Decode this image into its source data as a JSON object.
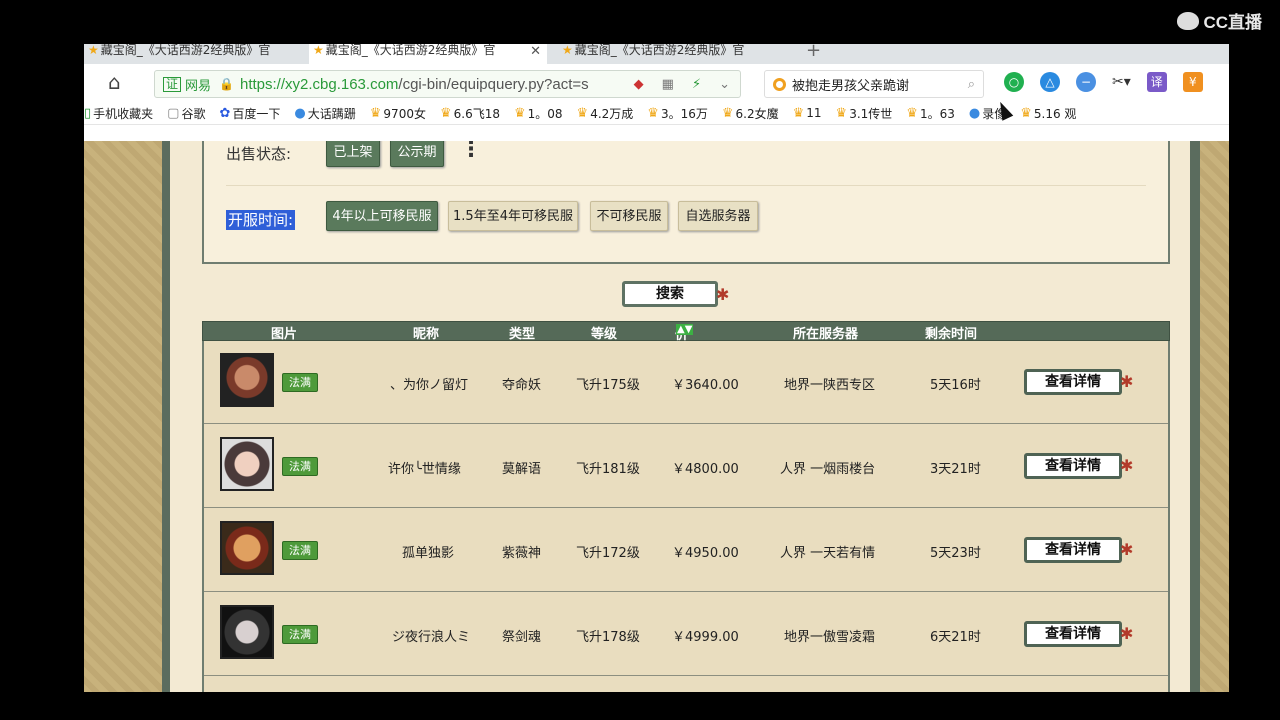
{
  "overlay": {
    "logo_text": "CC直播"
  },
  "tabs": [
    {
      "label": "藏宝阁_《大话西游2经典版》官",
      "active": false
    },
    {
      "label": "藏宝阁_《大话西游2经典版》官",
      "active": true
    },
    {
      "label": "藏宝阁_《大话西游2经典版》官",
      "active": false
    }
  ],
  "address": {
    "cert": "证",
    "site": "网易",
    "url_host": "https://xy2.cbg.163.com",
    "url_path": "/cgi-bin/equipquery.py?act=s"
  },
  "search_box": {
    "value": "被抱走男孩父亲跪谢"
  },
  "ext_translate": "译",
  "bookmarks": [
    {
      "label": "手机收藏夹"
    },
    {
      "label": "谷歌"
    },
    {
      "label": "百度一下"
    },
    {
      "label": "大话蹒跚"
    },
    {
      "label": "9700女"
    },
    {
      "label": "6.6飞18"
    },
    {
      "label": "1。08"
    },
    {
      "label": "4.2万成"
    },
    {
      "label": "3。16万"
    },
    {
      "label": "6.2女魔"
    },
    {
      "label": "11"
    },
    {
      "label": "3.1传世"
    },
    {
      "label": "1。63"
    },
    {
      "label": "录像"
    },
    {
      "label": "5.16 观"
    }
  ],
  "filters": {
    "sale_status_label": "出售状态:",
    "sale_options": [
      "已上架",
      "公示期"
    ],
    "open_time_label": "开服时间:",
    "open_options": [
      "4年以上可移民服",
      "1.5年至4年可移民服",
      "不可移民服",
      "自选服务器"
    ]
  },
  "search_button": "搜索",
  "table": {
    "headers": {
      "pic": "图片",
      "nick": "昵称",
      "type": "类型",
      "level": "等级",
      "price": "价格",
      "server": "所在服务器",
      "remain": "剩余时间"
    },
    "rows": [
      {
        "badge": "法满",
        "nick": "、为你ノ留灯",
        "type": "夺命妖",
        "level": "飞升175级",
        "price": "￥3640.00",
        "server": "地界一陕西专区",
        "remain": "5天16时",
        "detail": "查看详情"
      },
      {
        "badge": "法满",
        "nick": "许你╰世情缘",
        "type": "莫解语",
        "level": "飞升181级",
        "price": "￥4800.00",
        "server": "人界 一烟雨楼台",
        "remain": "3天21时",
        "detail": "查看详情"
      },
      {
        "badge": "法满",
        "nick": "孤单独影",
        "type": "紫薇神",
        "level": "飞升172级",
        "price": "￥4950.00",
        "server": "人界 一天若有情",
        "remain": "5天23时",
        "detail": "查看详情"
      },
      {
        "badge": "法满",
        "nick": "ジ夜行浪人ミ",
        "type": "祭剑魂",
        "level": "飞升178级",
        "price": "￥4999.00",
        "server": "地界一傲雪凌霜",
        "remain": "6天21时",
        "detail": "查看详情"
      }
    ]
  }
}
